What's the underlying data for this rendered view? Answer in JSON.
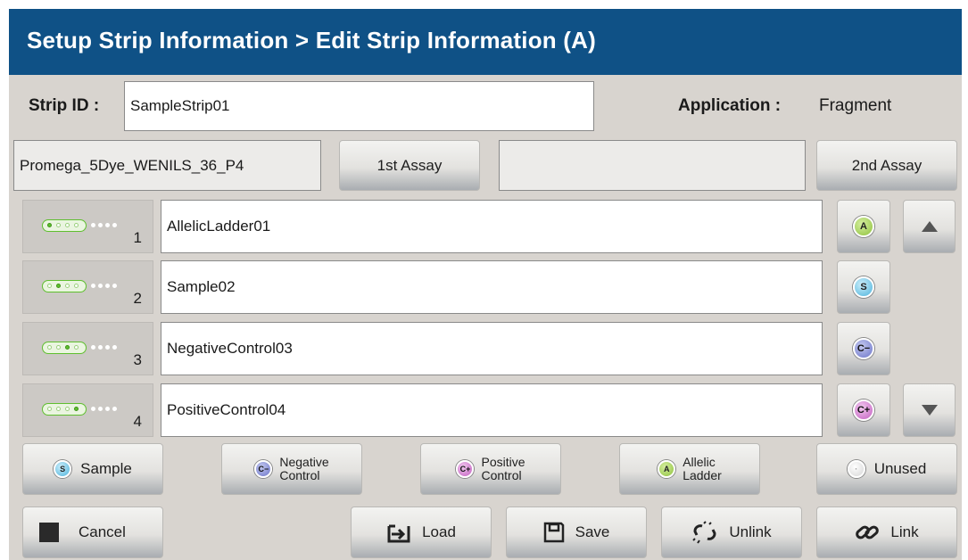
{
  "header": {
    "title": "Setup Strip Information > Edit Strip Information (A)"
  },
  "strip": {
    "id_label": "Strip ID :",
    "id_value": "SampleStrip01",
    "application_label": "Application :",
    "application_value": "Fragment"
  },
  "assays": {
    "first_value": "Promega_5Dye_WENILS_36_P4",
    "first_button": "1st Assay",
    "second_value": "",
    "second_button": "2nd Assay"
  },
  "wells": [
    {
      "number": "1",
      "name": "AllelicLadder01",
      "type_icon": "A",
      "active_dot": 1
    },
    {
      "number": "2",
      "name": "Sample02",
      "type_icon": "S",
      "active_dot": 2
    },
    {
      "number": "3",
      "name": "NegativeControl03",
      "type_icon": "C−",
      "active_dot": 3
    },
    {
      "number": "4",
      "name": "PositiveControl04",
      "type_icon": "C+",
      "active_dot": 4
    }
  ],
  "type_buttons": {
    "sample": {
      "icon": "S",
      "label": "Sample"
    },
    "negative": {
      "icon": "C−",
      "line1": "Negative",
      "line2": "Control"
    },
    "positive": {
      "icon": "C+",
      "line1": "Positive",
      "line2": "Control"
    },
    "allelic": {
      "icon": "A",
      "line1": "Allelic",
      "line2": "Ladder"
    },
    "unused": {
      "icon": "·",
      "label": "Unused"
    }
  },
  "actions": {
    "cancel": "Cancel",
    "load": "Load",
    "save": "Save",
    "unlink": "Unlink",
    "link": "Link"
  },
  "colors": {
    "header_bg": "#0f5186",
    "panel_bg": "#d8d4cf",
    "well_green": "#5fbf2f"
  }
}
